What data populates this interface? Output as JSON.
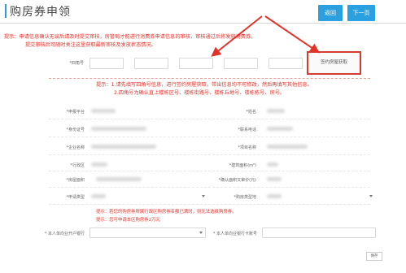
{
  "header": {
    "title": "购房券申领",
    "back_label": "返回",
    "next_label": "下一页"
  },
  "notice": {
    "line1": "提示：申请信息确认无误后请及时提交审核，房管局才能进行消费券申请信息的审核，审核通过后将发放消费券。",
    "line2": "提交审核后可随时关注这里获取最新审核及发放状态情况。"
  },
  "property": {
    "label": "*四角号",
    "lookup_button": "签约房屋获取"
  },
  "instructions": {
    "line1": "提示：1.请先填写四角号信息，进行签约房屋获取，带出信息均不可修改，然后再填写其他信息。",
    "line2": "2.四角号为确认直上楼栋区号、楼栋街路号、楼栋丘地号、楼栋栋号、房号。"
  },
  "form": {
    "left_labels": [
      "*申报平台",
      "*身份证号",
      "*企业名称",
      "*行政区",
      "*房屋面积",
      "*申请类型"
    ],
    "right_labels": [
      "*姓名",
      "*联系电话",
      "*项目名称",
      "*建筑面积(m²)",
      "*确认面积又审价(元)",
      "*购房类型地"
    ]
  },
  "tips": {
    "line1": "提示：若您的购房券所属行政区购房券名额已满时，则无法选择购房券。",
    "line2": "提示：您可申请本区购房券2万元"
  },
  "bank": {
    "left_label": "* 本人单向业开户银行",
    "right_label": "* 本人单向业银行卡账号"
  },
  "actions": {
    "save_label": "保存"
  },
  "colors": {
    "accent": "#2aa0e0",
    "warning": "#e2332a"
  }
}
